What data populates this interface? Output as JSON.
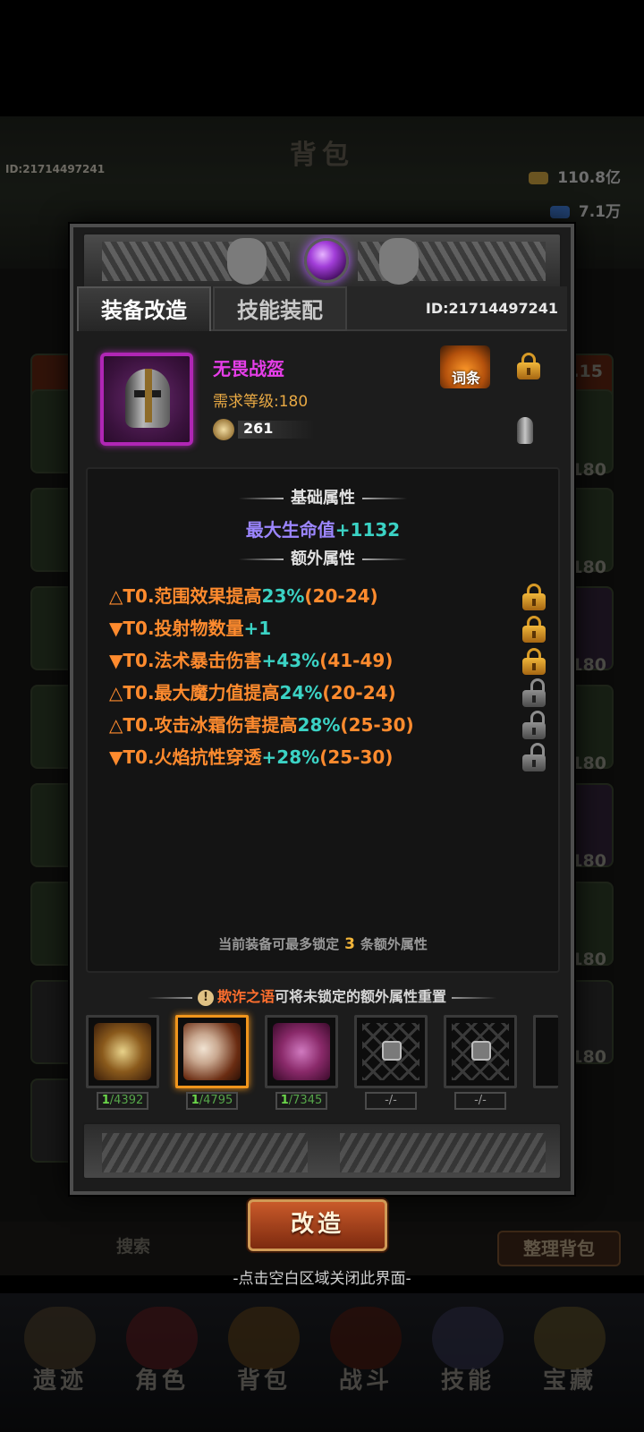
{
  "background": {
    "title": "背包",
    "player_id": "ID:21714497241",
    "currencies": [
      {
        "icon": "gold-coins-icon",
        "value": "110.8亿"
      },
      {
        "icon": "blue-crystal-icon",
        "value": "7.1万"
      }
    ],
    "slot_levels": [
      ".15",
      "180",
      "180",
      "180",
      "180",
      "180",
      "180",
      "180",
      "190"
    ],
    "bottom_bar": {
      "search_label": "搜索",
      "tidy_label": "整理背包"
    },
    "nav": [
      {
        "label": "遗迹",
        "icon": "relic-icon"
      },
      {
        "label": "角色",
        "icon": "character-icon"
      },
      {
        "label": "背包",
        "icon": "bag-icon"
      },
      {
        "label": "战斗",
        "icon": "battle-icon"
      },
      {
        "label": "技能",
        "icon": "skill-icon"
      },
      {
        "label": "宝藏",
        "icon": "treasure-icon"
      }
    ]
  },
  "dialog": {
    "tabs": [
      {
        "label": "装备改造",
        "active": true
      },
      {
        "label": "技能装配",
        "active": false
      }
    ],
    "player_id": "ID:21714497241",
    "item": {
      "name": "无畏战盔",
      "requirement": "需求等级:180",
      "power": "261",
      "affix_button": "词条",
      "name_color": "#e53ee8"
    },
    "base_title": "基础属性",
    "base_attr": {
      "name": "最大生命值",
      "value": "+1132"
    },
    "extra_title": "额外属性",
    "affixes": [
      {
        "prefix": "△T0.",
        "name": "范围效果提高",
        "value": "23%",
        "range": "(20-24)",
        "locked": true
      },
      {
        "prefix": "▼T0.",
        "name": "投射物数量",
        "value": "+1",
        "range": "",
        "locked": true
      },
      {
        "prefix": "▼T0.",
        "name": "法术暴击伤害",
        "value": "+43%",
        "range": "(41-49)",
        "locked": true
      },
      {
        "prefix": "△T0.",
        "name": "最大魔力值提高",
        "value": "24%",
        "range": "(20-24)",
        "locked": false
      },
      {
        "prefix": "△T0.",
        "name": "攻击冰霜伤害提高",
        "value": "28%",
        "range": "(25-30)",
        "locked": false
      },
      {
        "prefix": "▼T0.",
        "name": "火焰抗性穿透",
        "value": "+28%",
        "range": "(25-30)",
        "locked": false
      }
    ],
    "lock_note_before": "当前装备可最多锁定",
    "lock_note_count": "3",
    "lock_note_after": "条额外属性",
    "reset_hint_highlight": "欺诈之语",
    "reset_hint_rest": "可将未锁定的额外属性重置",
    "materials": [
      {
        "icon": "golden-orb-icon",
        "have": "1",
        "need": "/4392",
        "selected": false
      },
      {
        "icon": "twin-masks-icon",
        "have": "1",
        "need": "/4795",
        "selected": true
      },
      {
        "icon": "purple-scroll-icon",
        "have": "1",
        "need": "/7345",
        "selected": false
      },
      {
        "icon": "chained-lock-icon",
        "count": "-/-",
        "selected": false
      },
      {
        "icon": "chained-lock-icon",
        "count": "-/-",
        "selected": false
      }
    ],
    "reforge_label": "改造"
  },
  "close_hint": "-点击空白区域关闭此界面-",
  "colors": {
    "accent_orange": "#ff8b2e",
    "value_cyan": "#3bd2c4",
    "base_purple": "#9c86ff",
    "lock_gold": "#d79a26"
  }
}
